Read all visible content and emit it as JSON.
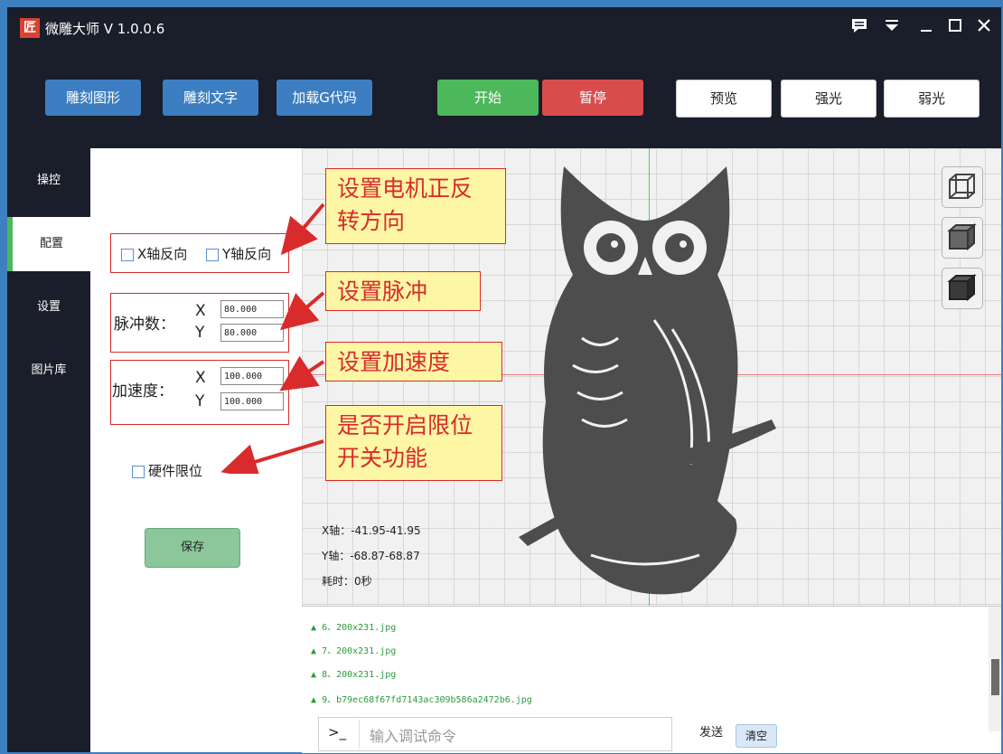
{
  "app": {
    "title": "微雕大师 V 1.0.0.6",
    "logo": "匠"
  },
  "titlebar_icons": [
    "chat-icon",
    "menu-down-icon",
    "minimize-icon",
    "maximize-icon",
    "close-icon"
  ],
  "toolbar": {
    "engrave_shape": "雕刻图形",
    "engrave_text": "雕刻文字",
    "load_gcode": "加载G代码",
    "start": "开始",
    "pause": "暂停",
    "preview": "预览",
    "strong_light": "强光",
    "weak_light": "弱光"
  },
  "sidebar": {
    "items": [
      {
        "label": "操控",
        "active": false
      },
      {
        "label": "配置",
        "active": true
      },
      {
        "label": "设置",
        "active": false
      },
      {
        "label": "图片库",
        "active": false
      }
    ]
  },
  "config": {
    "x_reverse": "X轴反向",
    "y_reverse": "Y轴反向",
    "pulse_label": "脉冲数：",
    "pulse_x": "80.000",
    "pulse_y": "80.000",
    "accel_label": "加速度：",
    "accel_x": "100.000",
    "accel_y": "100.000",
    "axis_x": "X",
    "axis_y": "Y",
    "hw_limit": "硬件限位",
    "save": "保存"
  },
  "callouts": {
    "motor": "设置电机正反转方向",
    "pulse": "设置脉冲",
    "accel": "设置加速度",
    "limit": "是否开启限位开关功能"
  },
  "canvas": {
    "x_range": "X轴：-41.95-41.95",
    "y_range": "Y轴：-68.87-68.87",
    "time": "耗时：0秒",
    "view_buttons": [
      "wireframe-cube-icon",
      "shaded-cube-icon",
      "solid-cube-icon"
    ]
  },
  "log": {
    "rows": [
      "6、200x231.jpg",
      "7、200x231.jpg",
      "8、200x231.jpg",
      "9、b79ec68f67fd7143ac309b586a2472b6.jpg"
    ],
    "prompt": ">_",
    "placeholder": "输入调试命令",
    "send": "发送",
    "clear": "清空"
  },
  "colors": {
    "accent_blue": "#3d7ec2",
    "start_green": "#4cb85b",
    "pause_red": "#d94c4c",
    "annotation_red": "#d92b2b"
  }
}
